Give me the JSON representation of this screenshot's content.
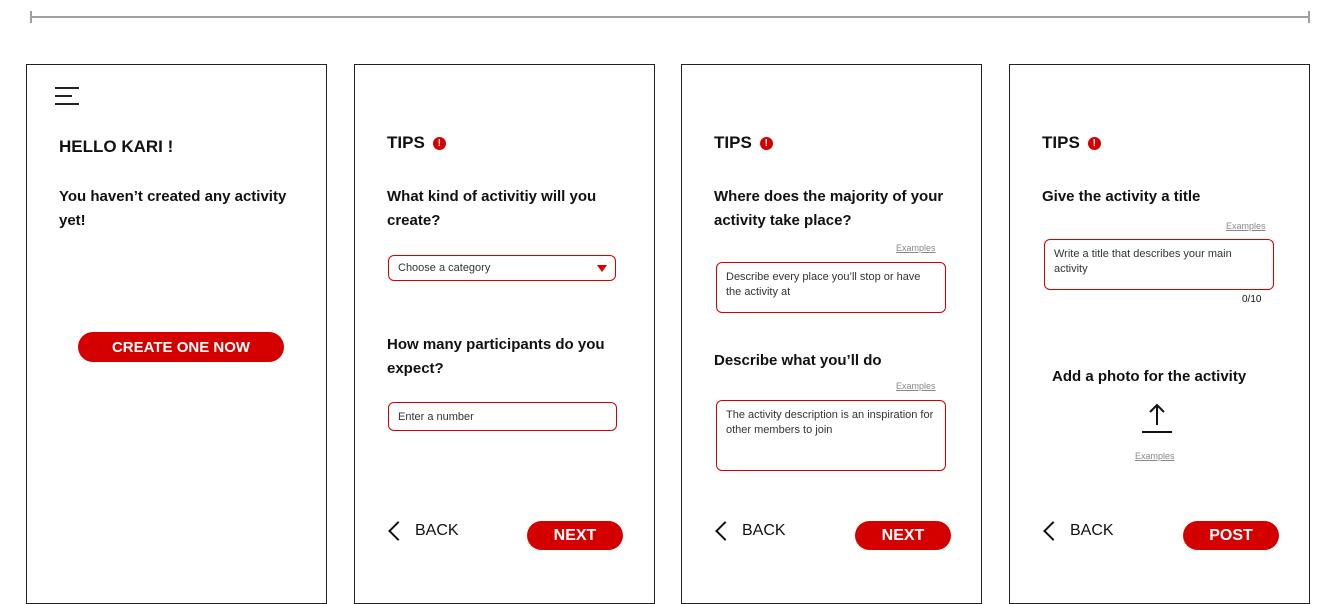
{
  "screen1": {
    "greeting": "HELLO KARI !",
    "message": "You haven’t created any activity yet!",
    "cta_label": "CREATE ONE NOW"
  },
  "screen2": {
    "tips_label": "TIPS",
    "alert_glyph": "!",
    "question_category": "What kind of activitiy will you create?",
    "category_placeholder": "Choose a category",
    "question_participants": "How many participants do you expect?",
    "participants_placeholder": "Enter a number",
    "back_label": "BACK",
    "next_label": "NEXT"
  },
  "screen3": {
    "tips_label": "TIPS",
    "alert_glyph": "!",
    "question_place": "Where does the majority of your activity take place?",
    "examples_label": "Examples",
    "place_placeholder": "Describe every place you’ll stop or have the activity at",
    "question_describe": "Describe what you’ll do",
    "description_placeholder": "The activity description is an inspiration for other members to join",
    "back_label": "BACK",
    "next_label": "NEXT"
  },
  "screen4": {
    "tips_label": "TIPS",
    "alert_glyph": "!",
    "question_title": "Give the activity a title",
    "examples_label": "Examples",
    "title_placeholder": "Write a title that describes your main activity",
    "char_counter": "0/10",
    "photo_label": "Add a photo for the activity",
    "back_label": "BACK",
    "post_label": "POST"
  },
  "colors": {
    "accent": "#d40000",
    "border": "#222222",
    "divider": "#a0a0a0"
  }
}
